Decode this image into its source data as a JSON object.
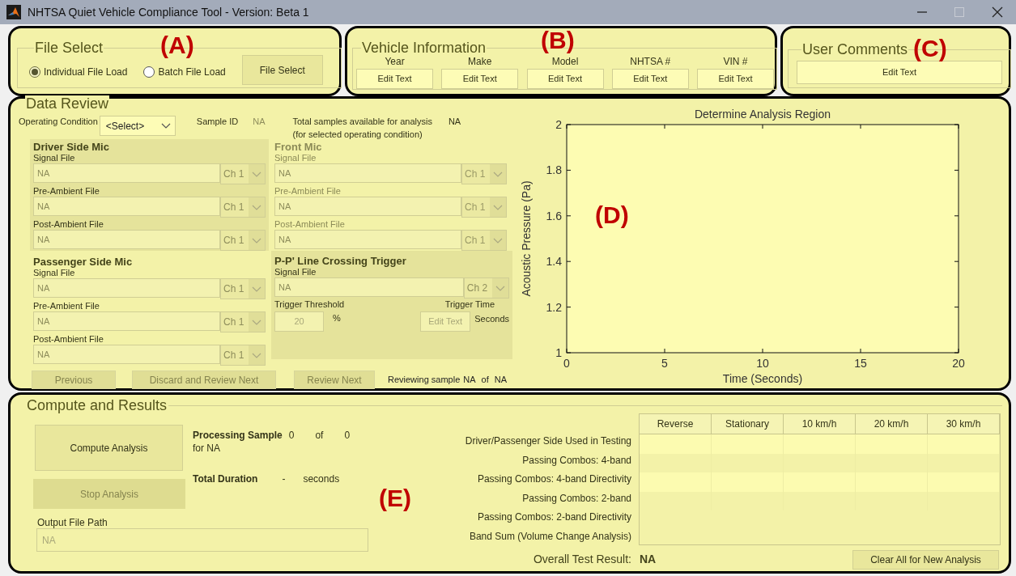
{
  "window": {
    "title": "NHTSA Quiet Vehicle Compliance Tool - Version: Beta 1"
  },
  "file_select": {
    "title": "File Select",
    "options": [
      {
        "label": "Individual File Load",
        "selected": true
      },
      {
        "label": "Batch File Load",
        "selected": false
      }
    ],
    "button": "File Select"
  },
  "vehicle_information": {
    "title": "Vehicle Information",
    "fields": [
      {
        "label": "Year",
        "value": "Edit Text"
      },
      {
        "label": "Make",
        "value": "Edit Text"
      },
      {
        "label": "Model",
        "value": "Edit Text"
      },
      {
        "label": "NHTSA #",
        "value": "Edit Text"
      },
      {
        "label": "VIN #",
        "value": "Edit Text"
      }
    ]
  },
  "user_comments": {
    "title": "User Comments",
    "value": "Edit Text"
  },
  "data_review": {
    "title": "Data Review",
    "operating_condition": {
      "label": "Operating Condition",
      "value": "<Select>"
    },
    "sample_id": {
      "label": "Sample ID",
      "value": "NA"
    },
    "total_samples": {
      "label": "Total samples available for analysis",
      "note": "(for selected operating condition)",
      "value": "NA"
    },
    "mics": [
      {
        "title": "Driver Side Mic",
        "disabled": false,
        "shaded": true,
        "files": [
          {
            "label": "Signal File",
            "value": "NA",
            "channel": "Ch 1"
          },
          {
            "label": "Pre-Ambient File",
            "value": "NA",
            "channel": "Ch 1"
          },
          {
            "label": "Post-Ambient File",
            "value": "NA",
            "channel": "Ch 1"
          }
        ]
      },
      {
        "title": "Front Mic",
        "disabled": true,
        "shaded": false,
        "files": [
          {
            "label": "Signal File",
            "value": "NA",
            "channel": "Ch 1"
          },
          {
            "label": "Pre-Ambient File",
            "value": "NA",
            "channel": "Ch 1"
          },
          {
            "label": "Post-Ambient File",
            "value": "NA",
            "channel": "Ch 1"
          }
        ]
      },
      {
        "title": "Passenger Side Mic",
        "disabled": false,
        "shaded": false,
        "files": [
          {
            "label": "Signal File",
            "value": "NA",
            "channel": "Ch 1"
          },
          {
            "label": "Pre-Ambient File",
            "value": "NA",
            "channel": "Ch 1"
          },
          {
            "label": "Post-Ambient File",
            "value": "NA",
            "channel": "Ch 1"
          }
        ]
      }
    ],
    "trigger": {
      "title": "P-P' Line Crossing Trigger",
      "signal_label": "Signal File",
      "signal_value": "NA",
      "channel": "Ch 2",
      "threshold_label": "Trigger Threshold",
      "threshold_value": "20",
      "threshold_unit": "%",
      "time_label": "Trigger Time",
      "time_value": "Edit Text",
      "time_unit": "Seconds"
    },
    "buttons": [
      {
        "label": "Previous",
        "disabled": true
      },
      {
        "label": "Discard and Review Next",
        "disabled": true
      },
      {
        "label": "Review Next",
        "disabled": true
      }
    ],
    "reviewing": {
      "label": "Reviewing sample",
      "current": "NA",
      "of": "of",
      "total": "NA"
    },
    "chart_data": {
      "type": "line",
      "title": "Determine Analysis Region",
      "xlabel": "Time (Seconds)",
      "ylabel": "Acoustic Pressure (Pa)",
      "xlim": [
        0,
        20
      ],
      "ylim": [
        1,
        2
      ],
      "xticks": [
        0,
        5,
        10,
        15,
        20
      ],
      "yticks": [
        1,
        1.2,
        1.4,
        1.6,
        1.8,
        2
      ]
    }
  },
  "compute_and_results": {
    "title": "Compute and Results",
    "compute_button": {
      "label": "Compute Analysis",
      "disabled": false
    },
    "stop_button": {
      "label": "Stop Analysis",
      "disabled": true
    },
    "output_path": {
      "label": "Output File Path",
      "value": "NA"
    },
    "processing": {
      "label": "Processing Sample",
      "current": "0",
      "of": "of",
      "total": "0",
      "for": "for NA"
    },
    "duration": {
      "label": "Total Duration",
      "value": "-",
      "unit": "seconds"
    },
    "row_labels": [
      "Driver/Passenger Side Used in Testing",
      "Passing Combos: 4-band",
      "Passing Combos: 4-band Directivity",
      "Passing Combos: 2-band",
      "Passing Combos: 2-band Directivity",
      "Band Sum (Volume Change Analysis)"
    ],
    "table": {
      "columns": [
        "Reverse",
        "Stationary",
        "10 km/h",
        "20 km/h",
        "30 km/h"
      ]
    },
    "overall": {
      "label": "Overall Test Result:",
      "value": "NA"
    },
    "clear_button": "Clear All for New Analysis"
  },
  "annotations": [
    {
      "label": "(A)"
    },
    {
      "label": "(B)"
    },
    {
      "label": "(C)"
    },
    {
      "label": "(D)"
    },
    {
      "label": "(E)"
    }
  ]
}
